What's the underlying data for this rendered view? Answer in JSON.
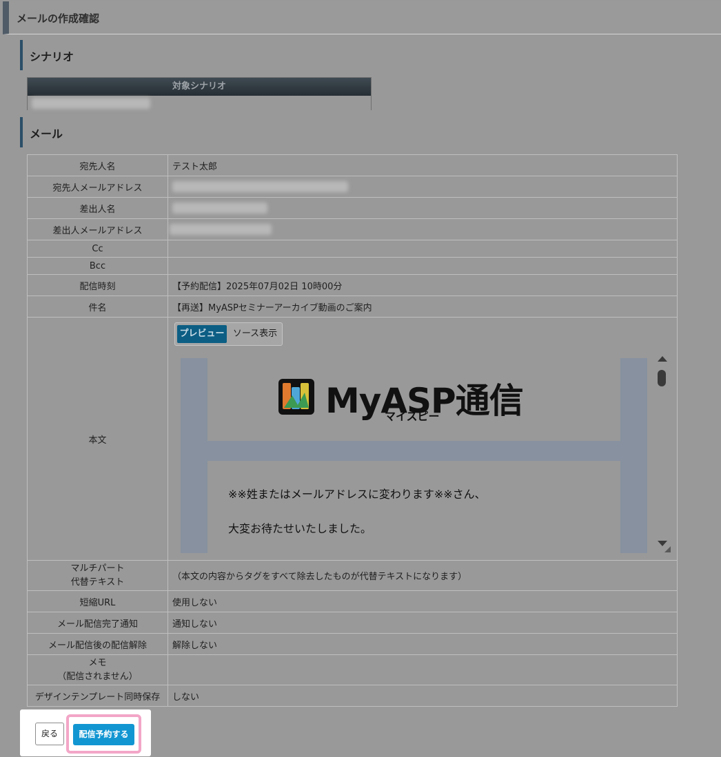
{
  "page": {
    "title": "メールの作成確認"
  },
  "scenario_section": {
    "heading": "シナリオ",
    "table_header": "対象シナリオ"
  },
  "mail_section": {
    "heading": "メール",
    "rows": {
      "to_name": {
        "label": "宛先人名",
        "value": "テスト太郎"
      },
      "to_email": {
        "label": "宛先人メールアドレス",
        "value": ""
      },
      "from_name": {
        "label": "差出人名",
        "value": ""
      },
      "from_email": {
        "label": "差出人メールアドレス",
        "value": ""
      },
      "cc": {
        "label": "Cc",
        "value": ""
      },
      "bcc": {
        "label": "Bcc",
        "value": ""
      },
      "send_time": {
        "label": "配信時刻",
        "value": "【予約配信】2025年07月02日 10時00分"
      },
      "subject": {
        "label": "件名",
        "value": "【再送】MyASPセミナーアーカイブ動画のご案内"
      },
      "body": {
        "label": "本文"
      },
      "multipart_1": {
        "label": "マルチパート"
      },
      "multipart_2": {
        "label": "代替テキスト"
      },
      "multipart_value": "（本文の内容からタグをすべて除去したものが代替テキストになります）",
      "short_url": {
        "label": "短縮URL",
        "value": "使用しない"
      },
      "complete_notice": {
        "label": "メール配信完了通知",
        "value": "通知しない"
      },
      "unsubscribe": {
        "label": "メール配信後の配信解除",
        "value": "解除しない"
      },
      "memo_1": {
        "label": "メモ"
      },
      "memo_2": {
        "label": "（配信されません）"
      },
      "memo_value": "",
      "design_template": {
        "label": "デザインテンプレート同時保存",
        "value": "しない"
      }
    }
  },
  "preview": {
    "tab_preview": "プレビュー",
    "tab_source": "ソース表示",
    "logo_text": "MyASP通信",
    "logo_sub": "マイスピー",
    "line1": "※※姓またはメールアドレスに変わります※※さん、",
    "line2": "大変お待たせいたしました。"
  },
  "buttons": {
    "back": "戻る",
    "reserve": "配信予約する"
  },
  "colors": {
    "highlight": "#f3a6c7",
    "primary_button": "#1296d2",
    "active_tab": "#0c5e84"
  }
}
